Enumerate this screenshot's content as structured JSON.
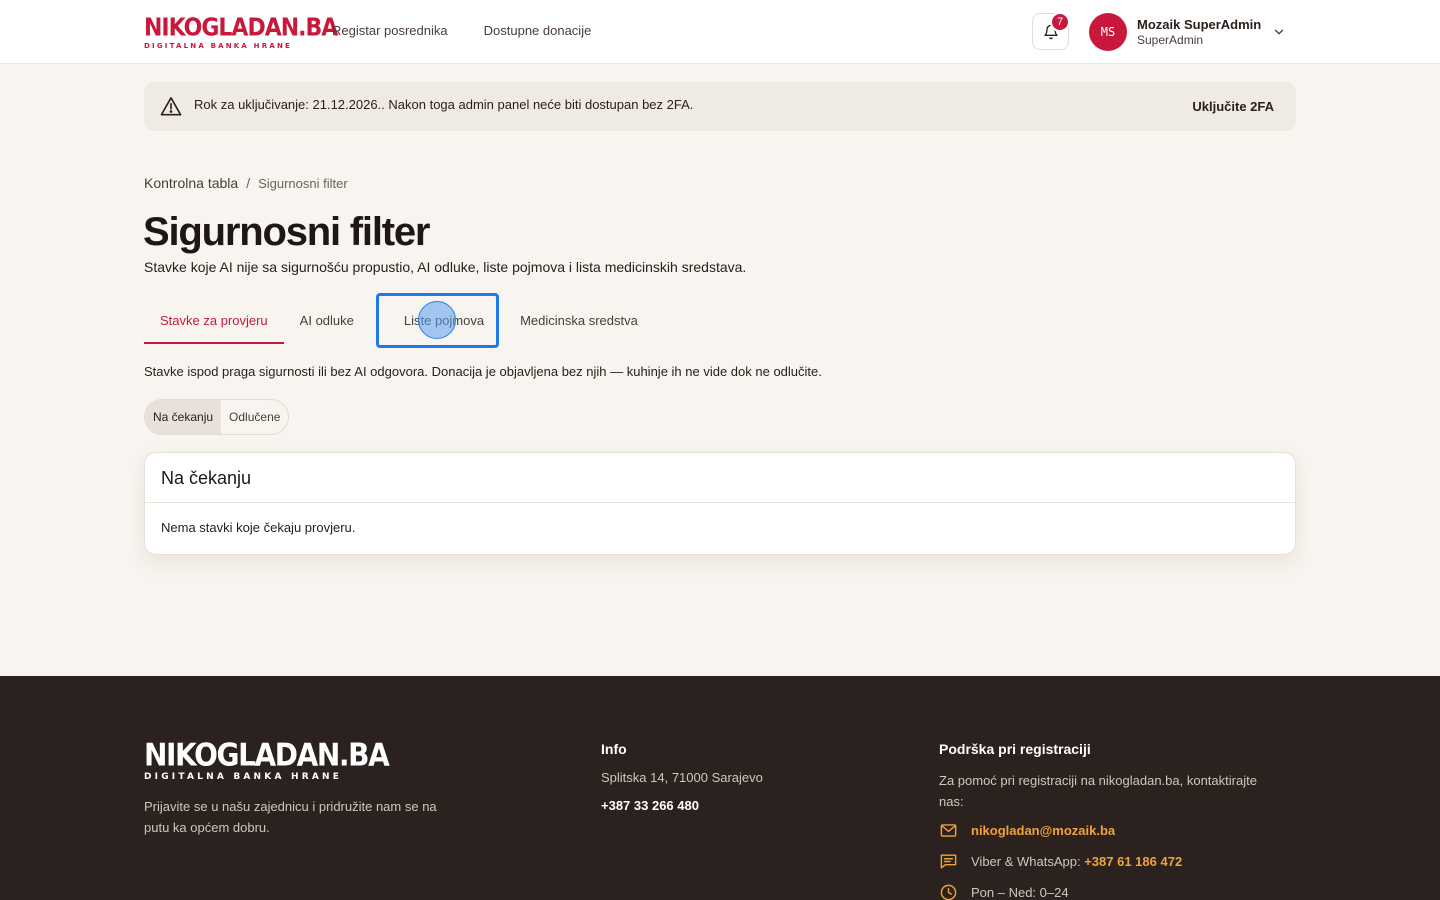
{
  "header": {
    "logo_main": "NIKOGLADAN.BA",
    "logo_sub": "DIGITALNA BANKA HRANE",
    "nav": [
      "Registar posrednika",
      "Dostupne donacije"
    ],
    "notification_count": "7",
    "user_initials": "MS",
    "user_name": "Mozaik SuperAdmin",
    "user_role": "SuperAdmin"
  },
  "banner": {
    "text": "Rok za uključivanje: 21.12.2026.. Nakon toga admin panel neće biti dostupan bez 2FA.",
    "action": "Uključite 2FA"
  },
  "breadcrumb": {
    "home": "Kontrolna tabla",
    "separator": "/",
    "current": "Sigurnosni filter"
  },
  "page": {
    "title": "Sigurnosni filter",
    "subtitle": "Stavke koje AI nije sa sigurnošću propustio, AI odluke, liste pojmova i lista medicinskih sredstava."
  },
  "tabs": [
    "Stavke za provjeru",
    "AI odluke",
    "Liste pojmova",
    "Medicinska sredstva"
  ],
  "active_tab": "Stavke za provjeru",
  "focused_tab": "Liste pojmova",
  "description": "Stavke ispod praga sigurnosti ili bez AI odgovora. Donacija je objavljena bez njih — kuhinje ih ne vide dok ne odlučite.",
  "segment": {
    "pending": "Na čekanju",
    "decided": "Odlučene"
  },
  "card": {
    "title": "Na čekanju",
    "empty": "Nema stavki koje čekaju provjeru."
  },
  "footer": {
    "logo_main": "NIKOGLADAN.BA",
    "logo_sub": "DIGITALNA BANKA HRANE",
    "tagline": "Prijavite se u našu zajednicu i pridružite nam se na putu ka općem dobru.",
    "info_title": "Info",
    "address": "Splitska 14, 71000 Sarajevo",
    "phone": "+387 33 266 480",
    "support_title": "Podrška pri registraciji",
    "support_text": "Za pomoć pri registraciji na nikogladan.ba, kontaktirajte nas:",
    "email": "nikogladan@mozaik.ba",
    "viber_label": "Viber & WhatsApp:",
    "viber_number": "+387 61 186 472",
    "hours": "Pon – Ned: 0–24"
  },
  "colors": {
    "brand_red": "#c8183c",
    "footer_bg": "#2b211e",
    "link_orange": "#f0a33a",
    "focus_blue": "#1e7ae8"
  },
  "icons": [
    "bell-icon",
    "chevron-down-icon",
    "warning-icon",
    "mail-icon",
    "chat-icon",
    "clock-icon"
  ]
}
